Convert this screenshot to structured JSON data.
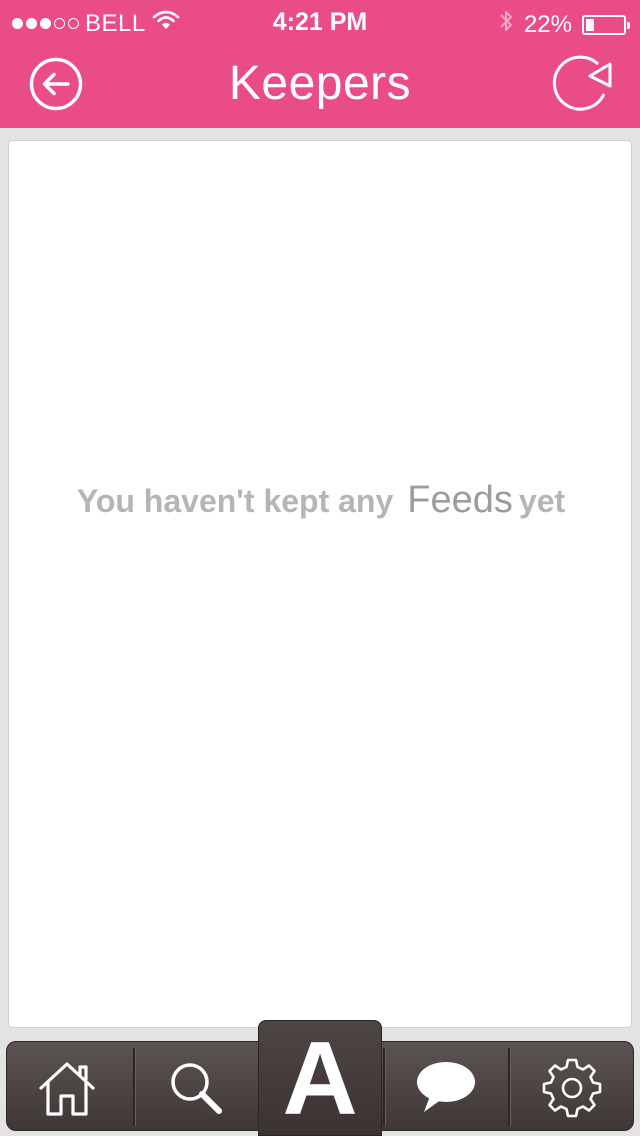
{
  "status_bar": {
    "signal": {
      "filled": 3,
      "total": 5
    },
    "carrier": "BELL",
    "wifi_icon": "wifi-icon",
    "time": "4:21 PM",
    "bluetooth_icon": "bluetooth-icon",
    "battery_percent": "22%",
    "battery_level": 0.22
  },
  "nav": {
    "title": "Keepers",
    "back_icon": "back-arrow-circle-icon",
    "refresh_icon": "refresh-icon",
    "color": "#ea4c88"
  },
  "content": {
    "empty_message_prefix": "You haven't kept any",
    "empty_message_highlight": "Feeds",
    "empty_message_suffix": "yet"
  },
  "tab_bar": {
    "tabs": [
      {
        "name": "home",
        "icon": "house-icon"
      },
      {
        "name": "search",
        "icon": "magnifier-icon"
      },
      {
        "name": "keepers",
        "label": "A",
        "active": true
      },
      {
        "name": "messages",
        "icon": "speech-bubble-icon"
      },
      {
        "name": "settings",
        "icon": "gear-icon"
      }
    ]
  }
}
